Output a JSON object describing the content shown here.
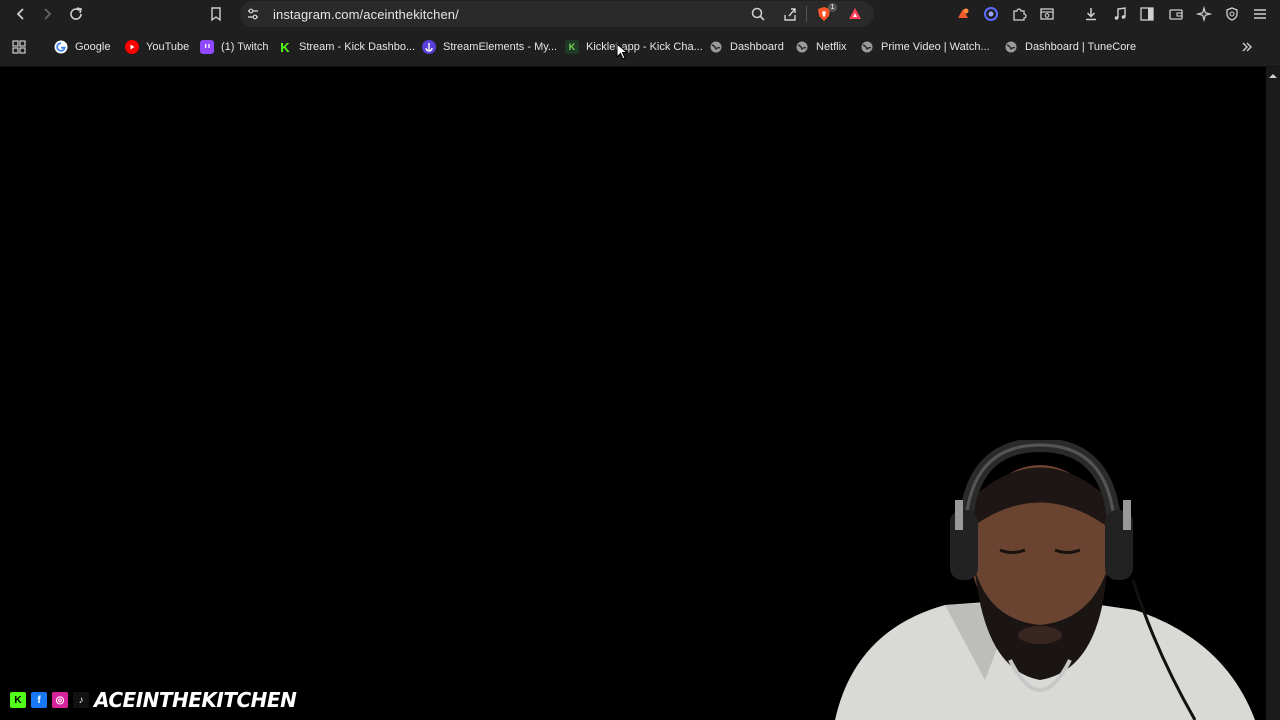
{
  "browser": {
    "url": "instagram.com/aceinthekitchen/",
    "nav_icons": [
      "back-icon",
      "forward-icon",
      "reload-icon",
      "bookmark-icon"
    ],
    "right_icons": [
      "zoom-icon",
      "share-icon",
      "brave-shield-icon",
      "brave-rewards-icon",
      "extension-orange-icon",
      "extension-circle-icon",
      "extensions-puzzle-icon",
      "tab-search-icon",
      "downloads-icon",
      "media-icon",
      "sidebar-icon",
      "wallet-icon",
      "leo-ai-icon",
      "vpn-icon",
      "menu-icon"
    ],
    "shield_badge": "1"
  },
  "bookmarks": [
    {
      "label": "Google",
      "icon": "google-icon",
      "color": "#ffffff"
    },
    {
      "label": "YouTube",
      "icon": "youtube-icon",
      "color": "#ff0000"
    },
    {
      "label": "(1) Twitch",
      "icon": "twitch-icon",
      "color": "#9146ff"
    },
    {
      "label": "Stream - Kick Dashbo...",
      "icon": "kick-icon",
      "color": "#53fc18"
    },
    {
      "label": "StreamElements - My...",
      "icon": "streamelements-icon",
      "color": "#5a3fd8"
    },
    {
      "label": "Kicklet.app - Kick Cha...",
      "icon": "kicklet-icon",
      "color": "#2e7d32"
    },
    {
      "label": "Dashboard",
      "icon": "globe-icon",
      "color": "#888888"
    },
    {
      "label": "Netflix",
      "icon": "globe-icon",
      "color": "#888888"
    },
    {
      "label": "Prime Video | Watch...",
      "icon": "globe-icon",
      "color": "#888888"
    },
    {
      "label": "Dashboard | TuneCore",
      "icon": "globe-icon",
      "color": "#888888"
    }
  ],
  "overlay": {
    "banner_text": "ACEINTHEKITCHEN",
    "social_icons": [
      "kick-icon",
      "facebook-icon",
      "instagram-icon",
      "tiktok-icon"
    ]
  },
  "colors": {
    "toolbar": "#1f1f1f",
    "page": "#000000",
    "kick": "#53fc18"
  }
}
